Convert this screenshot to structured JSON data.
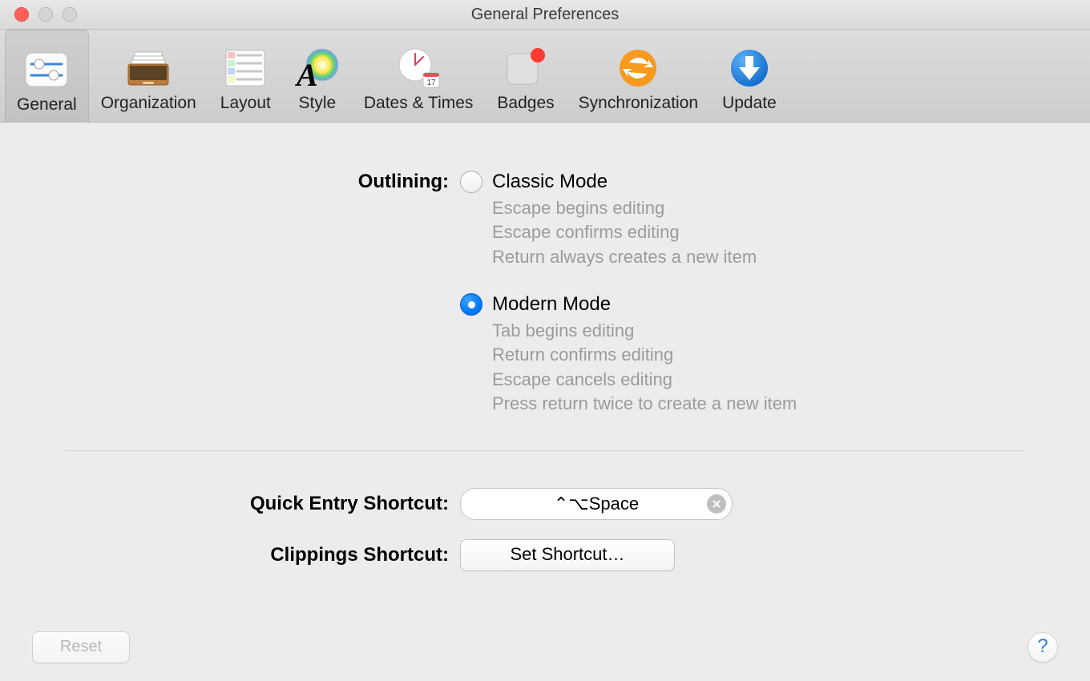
{
  "window": {
    "title": "General Preferences"
  },
  "toolbar": {
    "items": [
      {
        "id": "general",
        "label": "General",
        "selected": true
      },
      {
        "id": "organization",
        "label": "Organization",
        "selected": false
      },
      {
        "id": "layout",
        "label": "Layout",
        "selected": false
      },
      {
        "id": "style",
        "label": "Style",
        "selected": false
      },
      {
        "id": "dates-times",
        "label": "Dates & Times",
        "selected": false
      },
      {
        "id": "badges",
        "label": "Badges",
        "selected": false
      },
      {
        "id": "sync",
        "label": "Synchronization",
        "selected": false
      },
      {
        "id": "update",
        "label": "Update",
        "selected": false
      }
    ]
  },
  "outlining": {
    "section_label": "Outlining:",
    "classic": {
      "label": "Classic Mode",
      "selected": false,
      "desc1": "Escape begins editing",
      "desc2": "Escape confirms editing",
      "desc3": "Return always creates a new item"
    },
    "modern": {
      "label": "Modern Mode",
      "selected": true,
      "desc1": "Tab begins editing",
      "desc2": "Return confirms editing",
      "desc3": "Escape cancels editing",
      "desc4": "Press return twice to create a new item"
    }
  },
  "shortcuts": {
    "quick_entry": {
      "label": "Quick Entry Shortcut:",
      "value": "⌃⌥Space"
    },
    "clippings": {
      "label": "Clippings Shortcut:",
      "button": "Set Shortcut…"
    }
  },
  "footer": {
    "reset": "Reset",
    "help": "?"
  }
}
